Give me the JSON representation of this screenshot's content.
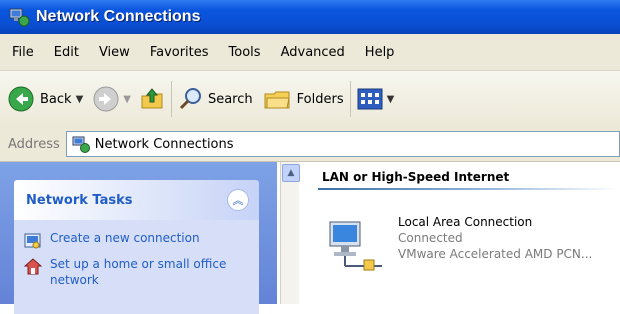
{
  "window": {
    "title": "Network Connections",
    "title_icon": "network-connections-icon"
  },
  "menu": [
    "File",
    "Edit",
    "View",
    "Favorites",
    "Tools",
    "Advanced",
    "Help"
  ],
  "toolbar": {
    "back_label": "Back",
    "search_label": "Search",
    "folders_label": "Folders",
    "icons": [
      "back-icon",
      "forward-icon",
      "up-folder-icon",
      "search-icon",
      "folders-icon",
      "views-icon"
    ]
  },
  "address": {
    "label": "Address",
    "value": "Network Connections"
  },
  "tasks": {
    "title": "Network Tasks",
    "items": [
      {
        "label": "Create a new connection",
        "icon": "new-connection-icon"
      },
      {
        "label": "Set up a home or small office network",
        "icon": "home-network-icon"
      }
    ]
  },
  "content": {
    "group_title": "LAN or High-Speed Internet",
    "connection": {
      "name": "Local Area Connection",
      "status": "Connected",
      "device": "VMware Accelerated AMD PCN..."
    }
  },
  "colors": {
    "title_blue": "#0a4fd4",
    "task_pane_blue": "#7ea2e6",
    "task_link": "#215dc6"
  }
}
